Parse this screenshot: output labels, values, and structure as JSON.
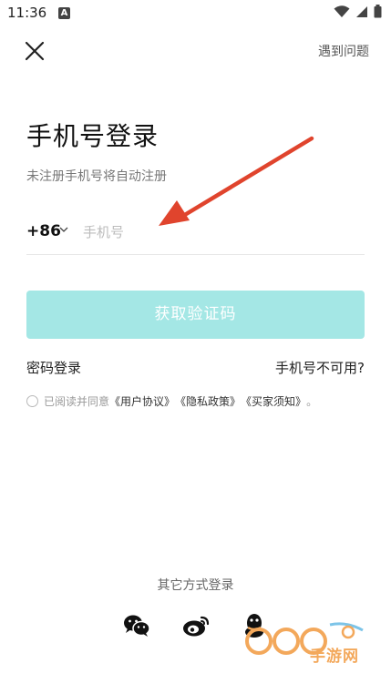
{
  "status_bar": {
    "time": "11:36",
    "notification_letter": "A"
  },
  "header": {
    "close_icon": "close-icon",
    "help_label": "遇到问题"
  },
  "login": {
    "title": "手机号登录",
    "subtitle": "未注册手机号将自动注册",
    "country_code": "+86",
    "phone_placeholder": "手机号",
    "phone_value": "",
    "verify_button": "获取验证码",
    "password_login": "密码登录",
    "phone_unavailable": "手机号不可用?"
  },
  "agreement": {
    "prefix": "已阅读并同意",
    "user_agreement": "《用户协议》",
    "privacy_policy": "《隐私政策》",
    "buyer_notice": "《买家须知》",
    "suffix": "。",
    "checked": false
  },
  "other_login": {
    "title": "其它方式登录",
    "icons": [
      "wechat-icon",
      "weibo-icon",
      "qq-icon"
    ]
  },
  "watermark": {
    "text": "手游网"
  },
  "colors": {
    "accent_button_disabled": "#a4e7e5",
    "arrow": "#e0442d",
    "watermark": "#f3a85b"
  }
}
